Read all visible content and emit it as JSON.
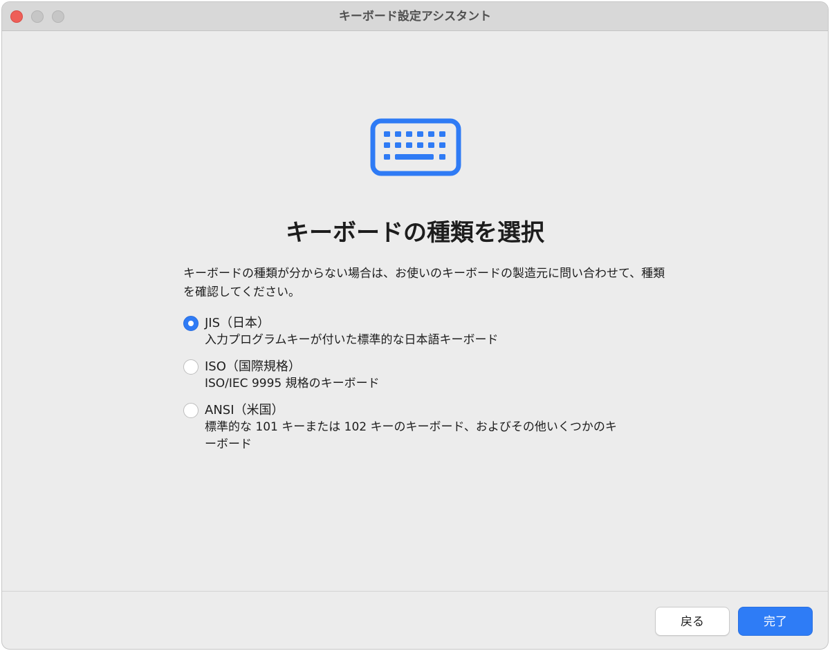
{
  "window": {
    "title": "キーボード設定アシスタント"
  },
  "icon": "keyboard-icon",
  "heading": "キーボードの種類を選択",
  "description": "キーボードの種類が分からない場合は、お使いのキーボードの製造元に問い合わせて、種類を確認してください。",
  "options": [
    {
      "title": "JIS（日本）",
      "description": "入力プログラムキーが付いた標準的な日本語キーボード",
      "selected": true
    },
    {
      "title": "ISO（国際規格）",
      "description": "ISO/IEC 9995 規格のキーボード",
      "selected": false
    },
    {
      "title": "ANSI（米国）",
      "description": "標準的な 101 キーまたは 102 キーのキーボード、およびその他いくつかのキーボード",
      "selected": false
    }
  ],
  "buttons": {
    "back_label": "戻る",
    "done_label": "完了"
  },
  "colors": {
    "accent": "#2e7cf6",
    "window_bg": "#ececec",
    "titlebar_bg": "#d8d8d8",
    "close_button": "#ee5f58"
  }
}
